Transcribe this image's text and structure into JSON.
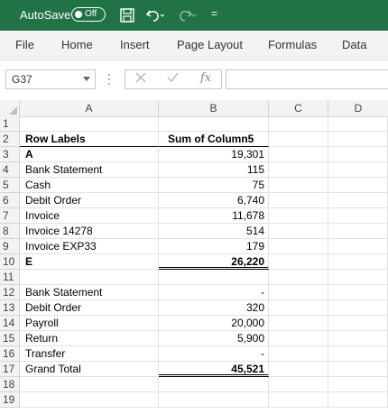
{
  "titlebar": {
    "autosave_label": "AutoSave",
    "toggle_state": "Off",
    "menu_glyph": "="
  },
  "ribbon": {
    "tabs": [
      "File",
      "Home",
      "Insert",
      "Page Layout",
      "Formulas",
      "Data"
    ]
  },
  "formula_bar": {
    "name_box": "G37",
    "fx_label": "fx",
    "formula": ""
  },
  "columns": [
    "A",
    "B",
    "C",
    "D"
  ],
  "rows": [
    {
      "num": "1",
      "a": "",
      "b": ""
    },
    {
      "num": "2",
      "a": "Row Labels",
      "b": "Sum of Column5"
    },
    {
      "num": "3",
      "a": "A",
      "b": "19,301"
    },
    {
      "num": "4",
      "a": "Bank Statement",
      "b": "115"
    },
    {
      "num": "5",
      "a": "Cash",
      "b": "75"
    },
    {
      "num": "6",
      "a": "Debit Order",
      "b": "6,740"
    },
    {
      "num": "7",
      "a": "Invoice",
      "b": "11,678"
    },
    {
      "num": "8",
      "a": "Invoice 14278",
      "b": "514"
    },
    {
      "num": "9",
      "a": "Invoice EXP33",
      "b": "179"
    },
    {
      "num": "10",
      "a": "E",
      "b": "26,220"
    },
    {
      "num": "11",
      "a": "",
      "b": ""
    },
    {
      "num": "12",
      "a": "Bank Statement",
      "b": "-"
    },
    {
      "num": "13",
      "a": "Debit Order",
      "b": "320"
    },
    {
      "num": "14",
      "a": "Payroll",
      "b": "20,000"
    },
    {
      "num": "15",
      "a": "Return",
      "b": "5,900"
    },
    {
      "num": "16",
      "a": "Transfer",
      "b": "-"
    },
    {
      "num": "17",
      "a": "Grand Total",
      "b": "45,521"
    },
    {
      "num": "18",
      "a": "",
      "b": ""
    },
    {
      "num": "19",
      "a": "",
      "b": ""
    }
  ],
  "colors": {
    "excel_green": "#217346",
    "ribbon_bg": "#f3f3f3"
  }
}
